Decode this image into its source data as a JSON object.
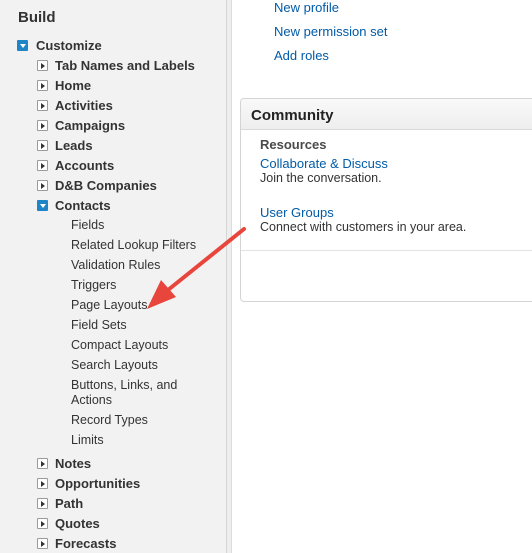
{
  "sidebar": {
    "build_title": "Build",
    "customize": {
      "label": "Customize",
      "items": [
        {
          "label": "Tab Names and Labels"
        },
        {
          "label": "Home"
        },
        {
          "label": "Activities"
        },
        {
          "label": "Campaigns"
        },
        {
          "label": "Leads"
        },
        {
          "label": "Accounts"
        },
        {
          "label": "D&B Companies"
        }
      ],
      "contacts": {
        "label": "Contacts",
        "children": [
          "Fields",
          "Related Lookup Filters",
          "Validation Rules",
          "Triggers",
          "Page Layouts",
          "Field Sets",
          "Compact Layouts",
          "Search Layouts",
          "Buttons, Links, and Actions",
          "Record Types",
          "Limits"
        ]
      },
      "after_items": [
        {
          "label": "Notes"
        },
        {
          "label": "Opportunities"
        },
        {
          "label": "Path"
        },
        {
          "label": "Quotes"
        },
        {
          "label": "Forecasts"
        }
      ]
    }
  },
  "main": {
    "links": [
      "New profile",
      "New permission set",
      "Add roles"
    ],
    "community": {
      "title": "Community",
      "resources_heading": "Resources",
      "items": [
        {
          "link": "Collaborate & Discuss",
          "desc": "Join the conversation."
        },
        {
          "link": "User Groups",
          "desc": "Connect with customers in your area."
        }
      ]
    }
  },
  "annotation": {
    "arrow_color": "#e8453c",
    "points_to": "Page Layouts"
  },
  "colors": {
    "link": "#015ba7",
    "toggle_open": "#1e85c7",
    "sidebar_bg": "#f2f2f2"
  }
}
